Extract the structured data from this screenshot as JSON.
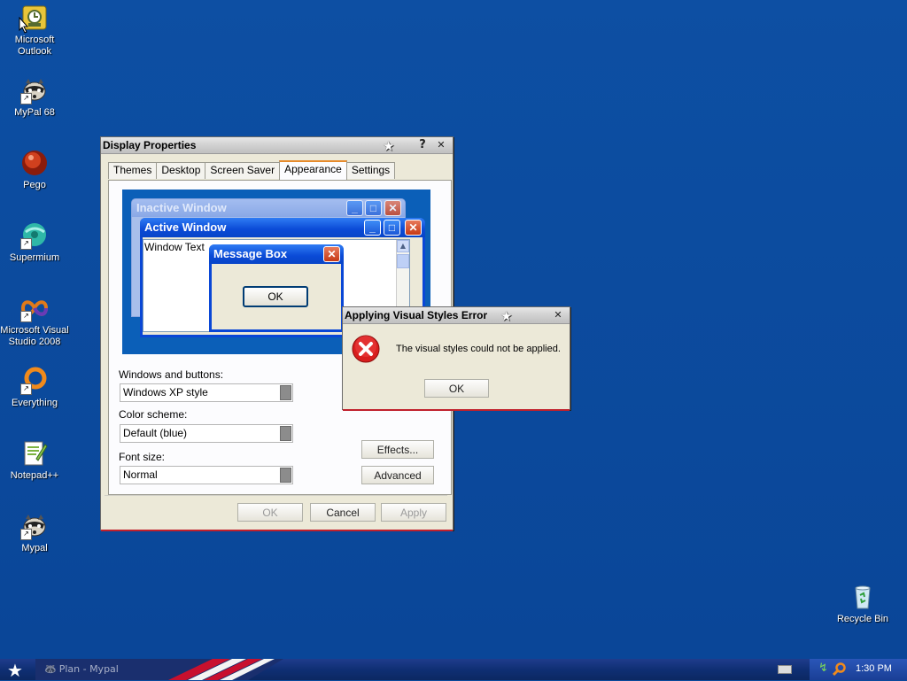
{
  "desktop_icons": [
    {
      "label": "Microsoft Outlook",
      "icon": "outlook-icon"
    },
    {
      "label": "MyPal 68",
      "icon": "raccoon-icon"
    },
    {
      "label": "Pego",
      "icon": "pego-icon"
    },
    {
      "label": "Supermium",
      "icon": "supermium-icon"
    },
    {
      "label": "Microsoft Visual Studio 2008",
      "icon": "visual-studio-icon"
    },
    {
      "label": "Everything",
      "icon": "everything-icon"
    },
    {
      "label": "Notepad++",
      "icon": "notepadpp-icon"
    },
    {
      "label": "Mypal",
      "icon": "raccoon-icon"
    },
    {
      "label": "Recycle Bin",
      "icon": "recycle-bin-icon"
    }
  ],
  "display_props": {
    "title": "Display Properties",
    "help": "?",
    "close": "✕",
    "tabs": [
      "Themes",
      "Desktop",
      "Screen Saver",
      "Appearance",
      "Settings"
    ],
    "active_tab": "Appearance",
    "preview": {
      "inactive_title": "Inactive Window",
      "active_title": "Active Window",
      "window_text": "Window Text",
      "msgbox_title": "Message Box",
      "msgbox_ok": "OK"
    },
    "windows_buttons_label": "Windows and buttons:",
    "windows_buttons_value": "Windows XP style",
    "color_scheme_label": "Color scheme:",
    "color_scheme_value": "Default (blue)",
    "font_size_label": "Font size:",
    "font_size_value": "Normal",
    "effects_button": "Effects...",
    "advanced_button": "Advanced",
    "ok_button": "OK",
    "cancel_button": "Cancel",
    "apply_button": "Apply"
  },
  "error_dialog": {
    "title": "Applying Visual Styles Error",
    "message": "The visual styles could not be applied.",
    "ok_button": "OK",
    "close": "✕"
  },
  "taskbar": {
    "task_label": "Plan - Mypal",
    "clock": "1:30 PM"
  },
  "colors": {
    "desktop": "#0b4a9c",
    "dialog_bg": "#ece9d8",
    "accent_red": "#c0202c"
  }
}
